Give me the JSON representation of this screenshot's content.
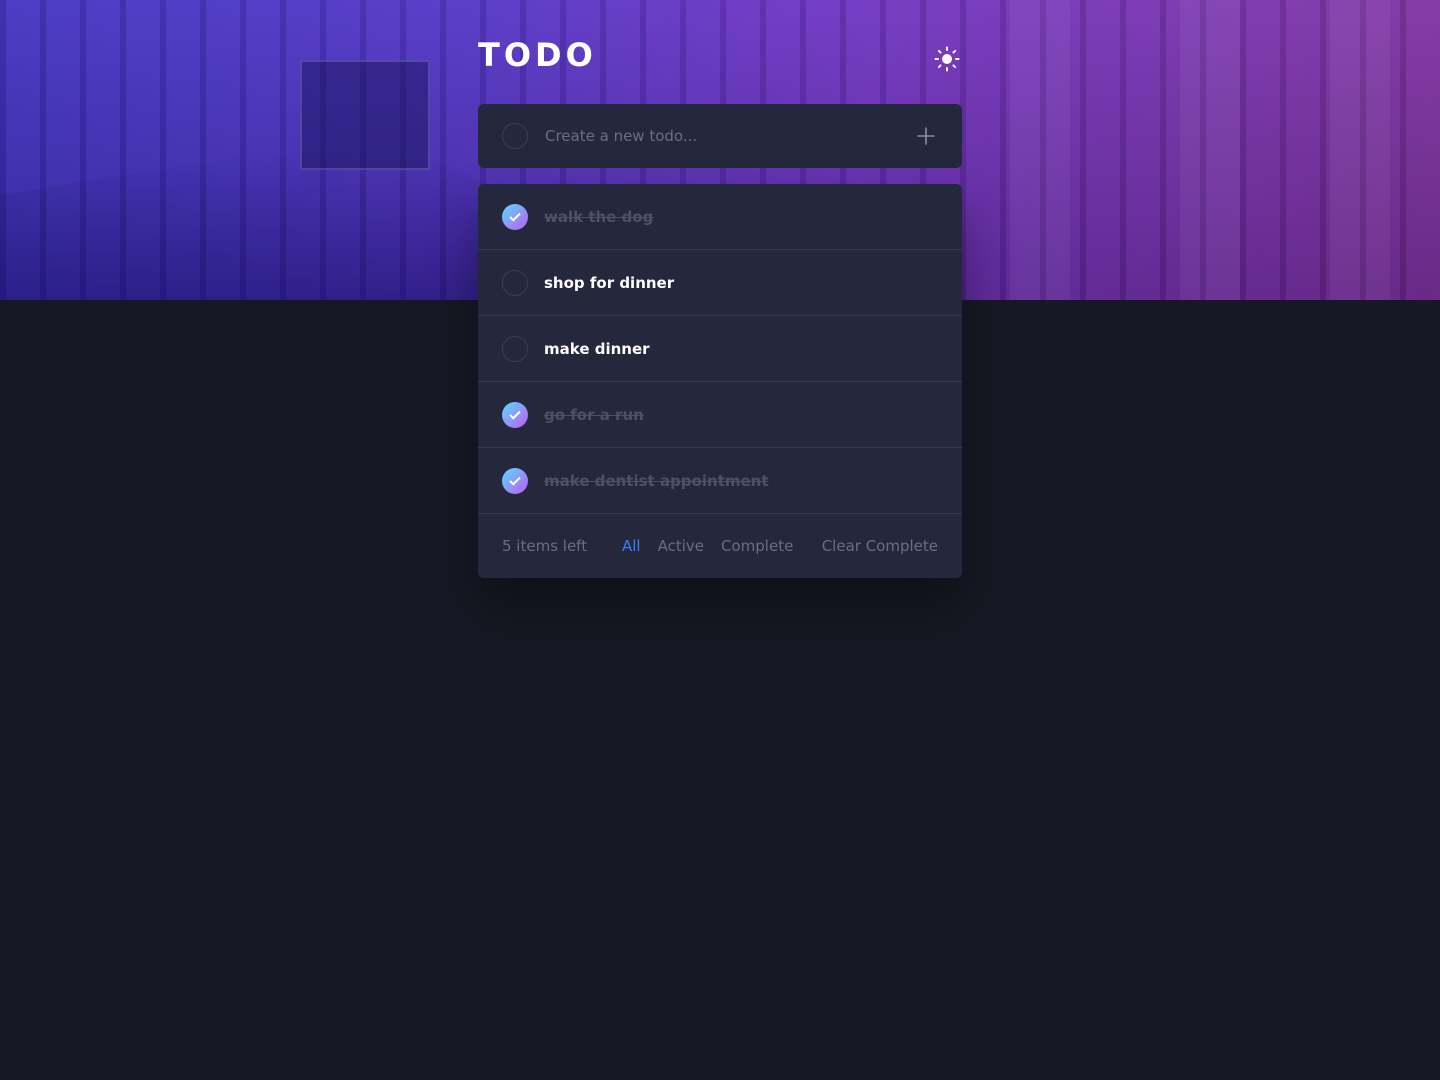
{
  "app": {
    "title": "TODO",
    "theme_icon": "sun-icon"
  },
  "new_todo": {
    "placeholder": "Create a new todo...",
    "add_icon": "plus-icon"
  },
  "todos": [
    {
      "text": "walk the dog",
      "completed": true
    },
    {
      "text": "shop for dinner",
      "completed": false
    },
    {
      "text": "make dinner",
      "completed": false
    },
    {
      "text": "go for a run",
      "completed": true
    },
    {
      "text": "make dentist appointment",
      "completed": true
    }
  ],
  "footer": {
    "items_left": "5 items left",
    "filters": [
      "All",
      "Active",
      "Complete"
    ],
    "active_filter": "All",
    "clear_label": "Clear Complete"
  },
  "colors": {
    "background": "#181824",
    "card": "#25273c",
    "accent": "#3a7bfd",
    "check_gradient_start": "#57ddff",
    "check_gradient_end": "#c058f3"
  }
}
